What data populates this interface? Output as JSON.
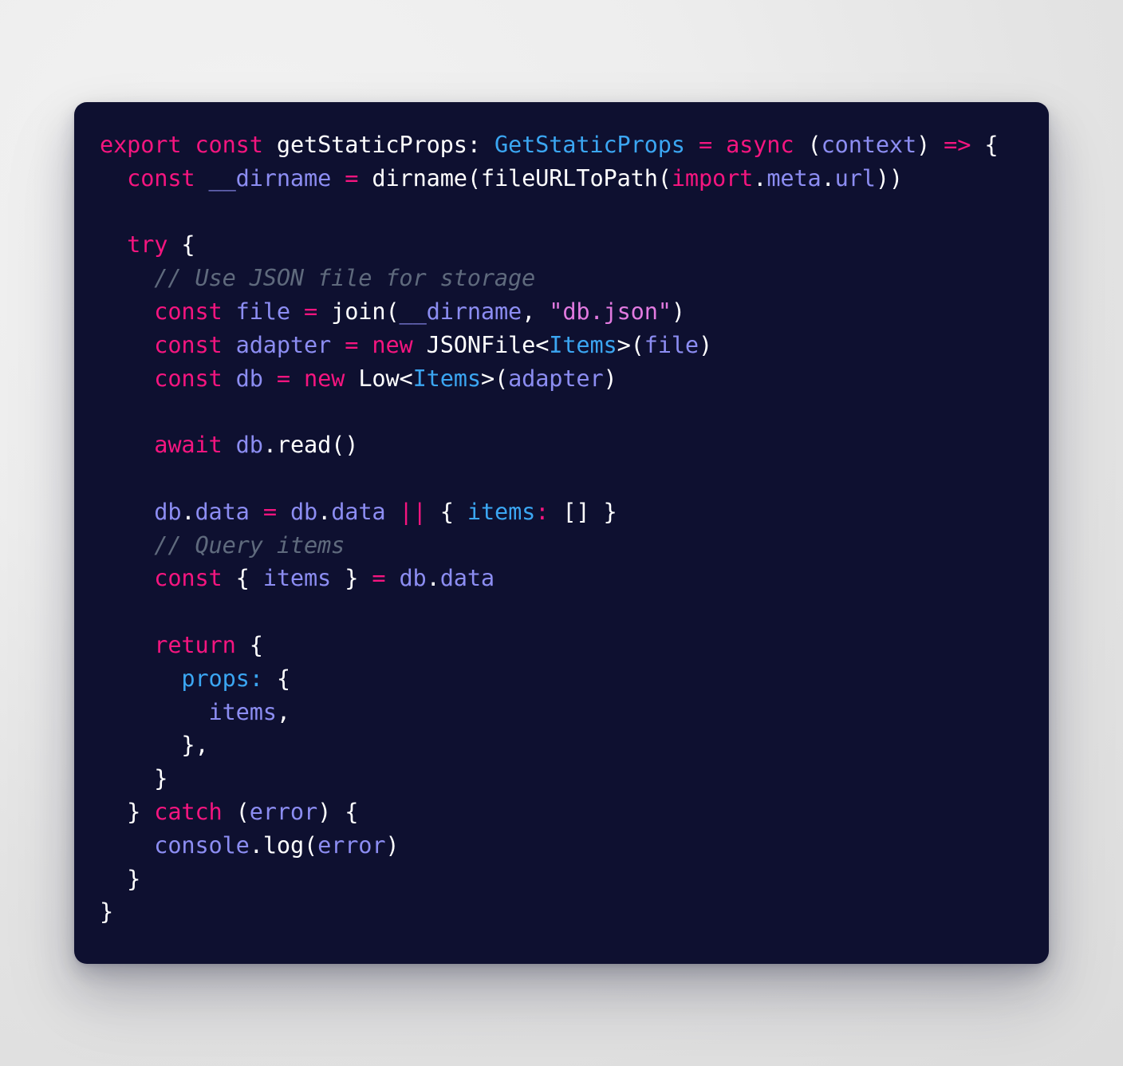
{
  "theme": {
    "card_background": "#0e1030",
    "page_background": "#ededed",
    "keyword_color": "#f4157f",
    "plain_color": "#ffffff",
    "type_color": "#3ba6f2",
    "variable_color": "#8c8df2",
    "string_color": "#e27ae0",
    "comment_color": "#5f6a7d"
  },
  "code": {
    "language": "typescript",
    "lines": [
      {
        "index": 1,
        "text": "export const getStaticProps: GetStaticProps = async (context) => {",
        "tokens": [
          {
            "t": "export",
            "c": "kw"
          },
          {
            "t": " ",
            "c": "plain"
          },
          {
            "t": "const",
            "c": "kw"
          },
          {
            "t": " ",
            "c": "plain"
          },
          {
            "t": "getStaticProps",
            "c": "plain"
          },
          {
            "t": ": ",
            "c": "plain"
          },
          {
            "t": "GetStaticProps",
            "c": "type"
          },
          {
            "t": " ",
            "c": "plain"
          },
          {
            "t": "=",
            "c": "kw"
          },
          {
            "t": " ",
            "c": "plain"
          },
          {
            "t": "async",
            "c": "kw"
          },
          {
            "t": " (",
            "c": "plain"
          },
          {
            "t": "context",
            "c": "var"
          },
          {
            "t": ") ",
            "c": "plain"
          },
          {
            "t": "=>",
            "c": "kw"
          },
          {
            "t": " {",
            "c": "plain"
          }
        ]
      },
      {
        "index": 2,
        "text": "  const __dirname = dirname(fileURLToPath(import.meta.url))",
        "tokens": [
          {
            "t": "  ",
            "c": "plain"
          },
          {
            "t": "const",
            "c": "kw"
          },
          {
            "t": " ",
            "c": "plain"
          },
          {
            "t": "__dirname",
            "c": "var"
          },
          {
            "t": " ",
            "c": "plain"
          },
          {
            "t": "=",
            "c": "kw"
          },
          {
            "t": " ",
            "c": "plain"
          },
          {
            "t": "dirname",
            "c": "plain"
          },
          {
            "t": "(",
            "c": "plain"
          },
          {
            "t": "fileURLToPath",
            "c": "plain"
          },
          {
            "t": "(",
            "c": "plain"
          },
          {
            "t": "import",
            "c": "kw"
          },
          {
            "t": ".",
            "c": "plain"
          },
          {
            "t": "meta",
            "c": "var"
          },
          {
            "t": ".",
            "c": "plain"
          },
          {
            "t": "url",
            "c": "var"
          },
          {
            "t": "))",
            "c": "plain"
          }
        ]
      },
      {
        "index": 3,
        "text": "",
        "tokens": []
      },
      {
        "index": 4,
        "text": "  try {",
        "tokens": [
          {
            "t": "  ",
            "c": "plain"
          },
          {
            "t": "try",
            "c": "kw"
          },
          {
            "t": " {",
            "c": "plain"
          }
        ]
      },
      {
        "index": 5,
        "text": "    // Use JSON file for storage",
        "tokens": [
          {
            "t": "    ",
            "c": "plain"
          },
          {
            "t": "// Use JSON file for storage",
            "c": "comment"
          }
        ]
      },
      {
        "index": 6,
        "text": "    const file = join(__dirname, \"db.json\")",
        "tokens": [
          {
            "t": "    ",
            "c": "plain"
          },
          {
            "t": "const",
            "c": "kw"
          },
          {
            "t": " ",
            "c": "plain"
          },
          {
            "t": "file",
            "c": "var"
          },
          {
            "t": " ",
            "c": "plain"
          },
          {
            "t": "=",
            "c": "kw"
          },
          {
            "t": " ",
            "c": "plain"
          },
          {
            "t": "join",
            "c": "plain"
          },
          {
            "t": "(",
            "c": "plain"
          },
          {
            "t": "__dirname",
            "c": "var"
          },
          {
            "t": ", ",
            "c": "plain"
          },
          {
            "t": "\"db.json\"",
            "c": "string"
          },
          {
            "t": ")",
            "c": "plain"
          }
        ]
      },
      {
        "index": 7,
        "text": "    const adapter = new JSONFile<Items>(file)",
        "tokens": [
          {
            "t": "    ",
            "c": "plain"
          },
          {
            "t": "const",
            "c": "kw"
          },
          {
            "t": " ",
            "c": "plain"
          },
          {
            "t": "adapter",
            "c": "var"
          },
          {
            "t": " ",
            "c": "plain"
          },
          {
            "t": "=",
            "c": "kw"
          },
          {
            "t": " ",
            "c": "plain"
          },
          {
            "t": "new",
            "c": "kw"
          },
          {
            "t": " ",
            "c": "plain"
          },
          {
            "t": "JSONFile",
            "c": "plain"
          },
          {
            "t": "<",
            "c": "plain"
          },
          {
            "t": "Items",
            "c": "type"
          },
          {
            "t": ">(",
            "c": "plain"
          },
          {
            "t": "file",
            "c": "var"
          },
          {
            "t": ")",
            "c": "plain"
          }
        ]
      },
      {
        "index": 8,
        "text": "    const db = new Low<Items>(adapter)",
        "tokens": [
          {
            "t": "    ",
            "c": "plain"
          },
          {
            "t": "const",
            "c": "kw"
          },
          {
            "t": " ",
            "c": "plain"
          },
          {
            "t": "db",
            "c": "var"
          },
          {
            "t": " ",
            "c": "plain"
          },
          {
            "t": "=",
            "c": "kw"
          },
          {
            "t": " ",
            "c": "plain"
          },
          {
            "t": "new",
            "c": "kw"
          },
          {
            "t": " ",
            "c": "plain"
          },
          {
            "t": "Low",
            "c": "plain"
          },
          {
            "t": "<",
            "c": "plain"
          },
          {
            "t": "Items",
            "c": "type"
          },
          {
            "t": ">(",
            "c": "plain"
          },
          {
            "t": "adapter",
            "c": "var"
          },
          {
            "t": ")",
            "c": "plain"
          }
        ]
      },
      {
        "index": 9,
        "text": "",
        "tokens": []
      },
      {
        "index": 10,
        "text": "    await db.read()",
        "tokens": [
          {
            "t": "    ",
            "c": "plain"
          },
          {
            "t": "await",
            "c": "kw"
          },
          {
            "t": " ",
            "c": "plain"
          },
          {
            "t": "db",
            "c": "var"
          },
          {
            "t": ".",
            "c": "plain"
          },
          {
            "t": "read",
            "c": "plain"
          },
          {
            "t": "()",
            "c": "plain"
          }
        ]
      },
      {
        "index": 11,
        "text": "",
        "tokens": []
      },
      {
        "index": 12,
        "text": "    db.data = db.data || { items: [] }",
        "tokens": [
          {
            "t": "    ",
            "c": "plain"
          },
          {
            "t": "db",
            "c": "var"
          },
          {
            "t": ".",
            "c": "plain"
          },
          {
            "t": "data",
            "c": "var"
          },
          {
            "t": " ",
            "c": "plain"
          },
          {
            "t": "=",
            "c": "kw"
          },
          {
            "t": " ",
            "c": "plain"
          },
          {
            "t": "db",
            "c": "var"
          },
          {
            "t": ".",
            "c": "plain"
          },
          {
            "t": "data",
            "c": "var"
          },
          {
            "t": " ",
            "c": "plain"
          },
          {
            "t": "||",
            "c": "kw"
          },
          {
            "t": " { ",
            "c": "plain"
          },
          {
            "t": "items",
            "c": "type"
          },
          {
            "t": ":",
            "c": "kw"
          },
          {
            "t": " [] }",
            "c": "plain"
          }
        ]
      },
      {
        "index": 13,
        "text": "    // Query items",
        "tokens": [
          {
            "t": "    ",
            "c": "plain"
          },
          {
            "t": "// Query items",
            "c": "comment"
          }
        ]
      },
      {
        "index": 14,
        "text": "    const { items } = db.data",
        "tokens": [
          {
            "t": "    ",
            "c": "plain"
          },
          {
            "t": "const",
            "c": "kw"
          },
          {
            "t": " { ",
            "c": "plain"
          },
          {
            "t": "items",
            "c": "var"
          },
          {
            "t": " } ",
            "c": "plain"
          },
          {
            "t": "=",
            "c": "kw"
          },
          {
            "t": " ",
            "c": "plain"
          },
          {
            "t": "db",
            "c": "var"
          },
          {
            "t": ".",
            "c": "plain"
          },
          {
            "t": "data",
            "c": "var"
          }
        ]
      },
      {
        "index": 15,
        "text": "",
        "tokens": []
      },
      {
        "index": 16,
        "text": "    return {",
        "tokens": [
          {
            "t": "    ",
            "c": "plain"
          },
          {
            "t": "return",
            "c": "kw"
          },
          {
            "t": " {",
            "c": "plain"
          }
        ]
      },
      {
        "index": 17,
        "text": "      props: {",
        "tokens": [
          {
            "t": "      ",
            "c": "plain"
          },
          {
            "t": "props:",
            "c": "type"
          },
          {
            "t": " {",
            "c": "plain"
          }
        ]
      },
      {
        "index": 18,
        "text": "        items,",
        "tokens": [
          {
            "t": "        ",
            "c": "plain"
          },
          {
            "t": "items",
            "c": "var"
          },
          {
            "t": ",",
            "c": "plain"
          }
        ]
      },
      {
        "index": 19,
        "text": "      },",
        "tokens": [
          {
            "t": "      },",
            "c": "plain"
          }
        ]
      },
      {
        "index": 20,
        "text": "    }",
        "tokens": [
          {
            "t": "    }",
            "c": "plain"
          }
        ]
      },
      {
        "index": 21,
        "text": "  } catch (error) {",
        "tokens": [
          {
            "t": "  } ",
            "c": "plain"
          },
          {
            "t": "catch",
            "c": "kw"
          },
          {
            "t": " (",
            "c": "plain"
          },
          {
            "t": "error",
            "c": "var"
          },
          {
            "t": ") {",
            "c": "plain"
          }
        ]
      },
      {
        "index": 22,
        "text": "    console.log(error)",
        "tokens": [
          {
            "t": "    ",
            "c": "plain"
          },
          {
            "t": "console",
            "c": "var"
          },
          {
            "t": ".",
            "c": "plain"
          },
          {
            "t": "log",
            "c": "plain"
          },
          {
            "t": "(",
            "c": "plain"
          },
          {
            "t": "error",
            "c": "var"
          },
          {
            "t": ")",
            "c": "plain"
          }
        ]
      },
      {
        "index": 23,
        "text": "  }",
        "tokens": [
          {
            "t": "  }",
            "c": "plain"
          }
        ]
      },
      {
        "index": 24,
        "text": "}",
        "tokens": [
          {
            "t": "}",
            "c": "plain"
          }
        ]
      }
    ]
  }
}
